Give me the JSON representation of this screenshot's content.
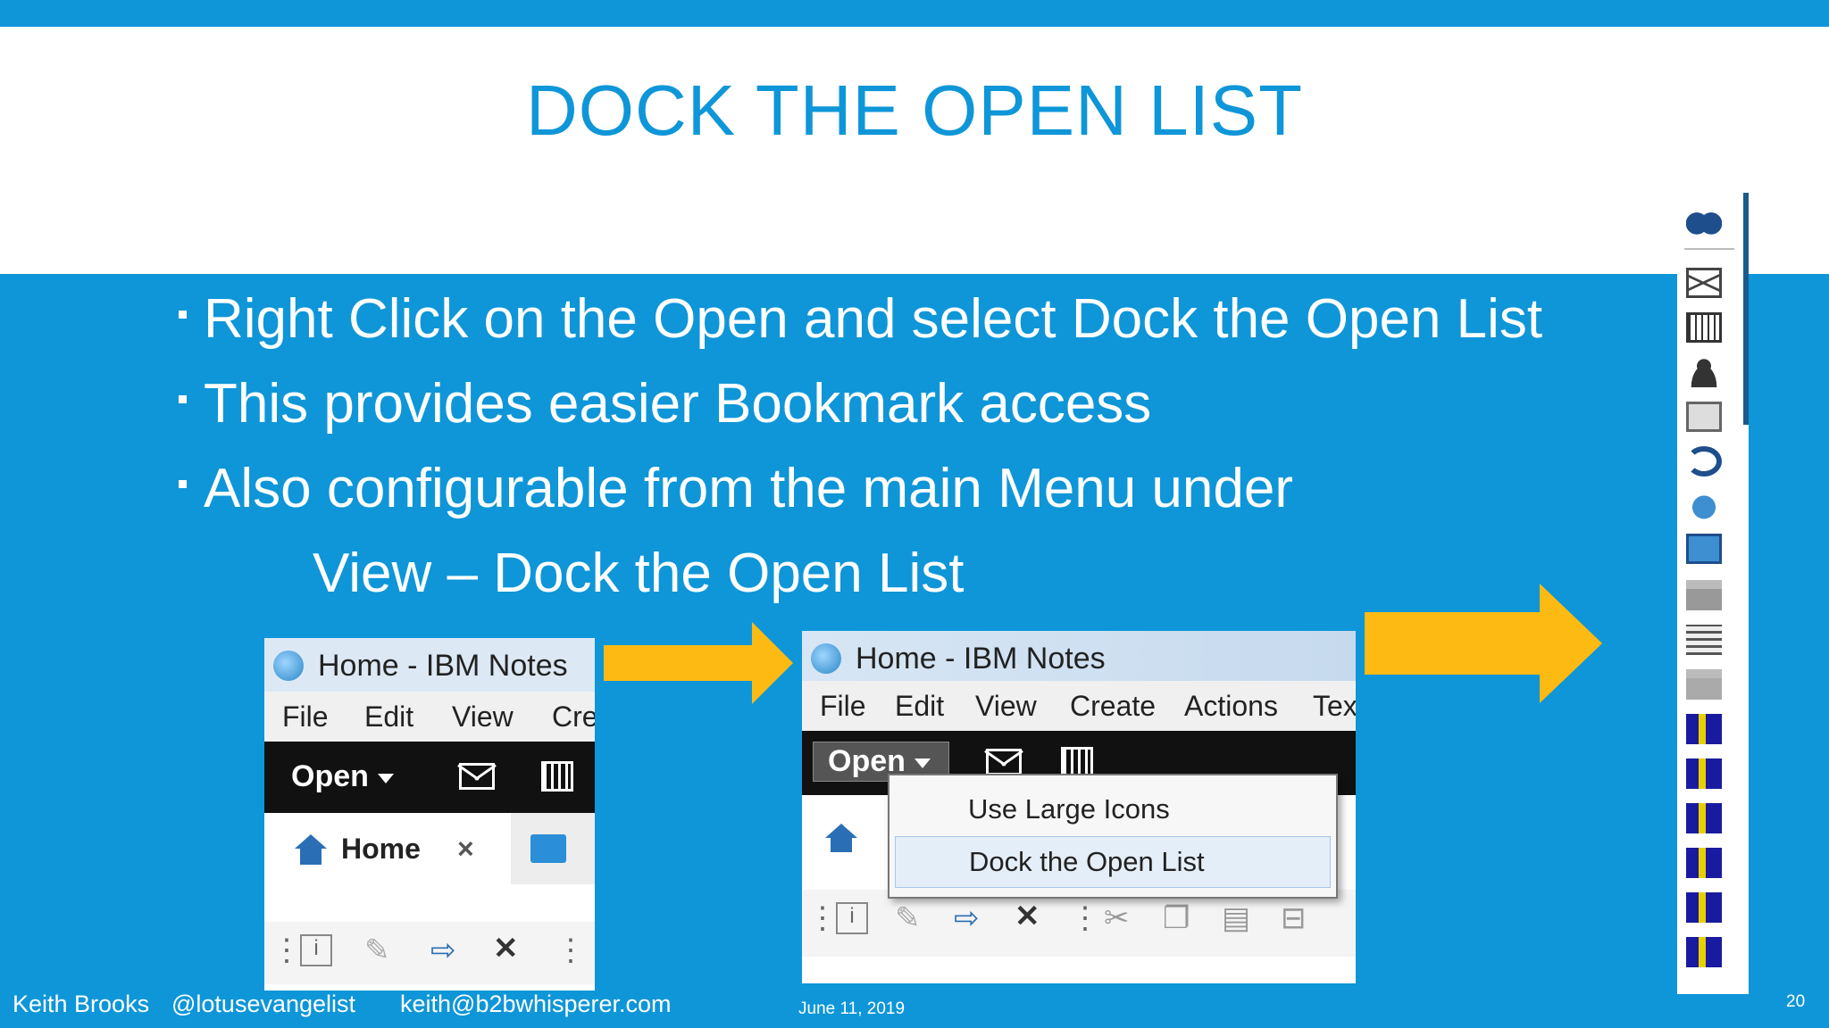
{
  "slide": {
    "title": "DOCK THE OPEN LIST",
    "bullets": [
      "Right Click on the Open and select Dock the Open List",
      "This provides easier Bookmark access",
      "Also configurable from the main Menu under"
    ],
    "sub_line": "View – Dock the Open List",
    "page_number": "20"
  },
  "footer": {
    "author": "Keith Brooks",
    "handle": "@lotusevangelist",
    "email": "keith@b2bwhisperer.com",
    "date": "June 11, 2019"
  },
  "screenshot_left": {
    "window_title": "Home - IBM Notes",
    "menu": [
      "File",
      "Edit",
      "View",
      "Cre"
    ],
    "open_button": "Open",
    "tab_label": "Home",
    "tab_close": "×"
  },
  "screenshot_middle": {
    "window_title": "Home - IBM Notes",
    "menu": [
      "File",
      "Edit",
      "View",
      "Create",
      "Actions",
      "Tex"
    ],
    "open_button": "Open",
    "context_menu": [
      "Use Large Icons",
      "Dock the Open List"
    ]
  },
  "colors": {
    "background": "#0E96D8",
    "title": "#0E96D8",
    "arrow": "#FDBA13",
    "text": "#FFFFFF"
  },
  "dock_icons": [
    "binoculars-icon",
    "mail-icon",
    "calendar-icon",
    "contacts-icon",
    "todo-icon",
    "sync-icon",
    "bottle-icon",
    "replication-icon",
    "favorites-folder-icon",
    "workspace-icon",
    "folder-icon",
    "database-icon",
    "database-icon",
    "database-icon",
    "database-icon",
    "database-icon",
    "database-icon"
  ]
}
